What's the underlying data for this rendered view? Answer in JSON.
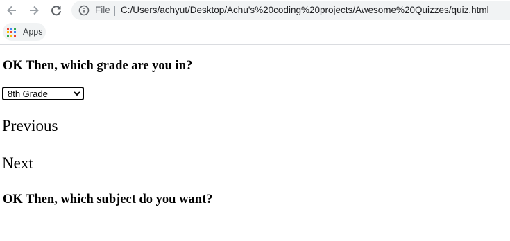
{
  "browser": {
    "back_icon": "arrow-left-icon",
    "forward_icon": "arrow-right-icon",
    "reload_icon": "reload-icon",
    "info_icon": "info-circle-icon",
    "scheme_label": "File",
    "url": "C:/Users/achyut/Desktop/Achu's%20coding%20projects/Awesome%20Quizzes/quiz.html",
    "bookmarks": {
      "apps_icon": "apps-grid-icon",
      "apps_label": "Apps"
    }
  },
  "page": {
    "grade_question": "OK Then, which grade are you in?",
    "grade_select": {
      "selected": "8th Grade"
    },
    "previous_label": "Previous",
    "next_label": "Next",
    "subject_question": "OK Then, which subject do you want?"
  },
  "colors": {
    "omnibox_bg": "#f1f3f4",
    "chrome_icon": "#5f6368",
    "apps_red": "#ea4335",
    "apps_yellow": "#fbbc05",
    "apps_green": "#34a853",
    "apps_blue": "#4285f4"
  }
}
